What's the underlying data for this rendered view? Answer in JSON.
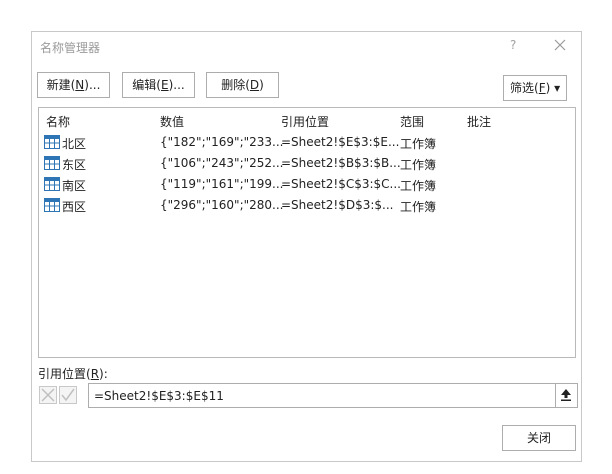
{
  "window": {
    "title": "名称管理器",
    "help": "?"
  },
  "toolbar": {
    "new_label": "新建(",
    "new_key": "N",
    "new_suffix": ")...",
    "edit_label": "编辑(",
    "edit_key": "E",
    "edit_suffix": ")...",
    "delete_label": "删除(",
    "delete_key": "D",
    "delete_suffix": ")",
    "filter_label": "筛选(",
    "filter_key": "F",
    "filter_suffix": ") ▾"
  },
  "list": {
    "headers": {
      "name": "名称",
      "value": "数值",
      "refers_to": "引用位置",
      "scope": "范围",
      "comment": "批注"
    },
    "rows": [
      {
        "icon": "named-range-icon",
        "name": "北区",
        "value": "{\"182\";\"169\";\"233...",
        "refers_to": "=Sheet2!$E$3:$E...",
        "scope": "工作簿",
        "comment": ""
      },
      {
        "icon": "named-range-icon",
        "name": "东区",
        "value": "{\"106\";\"243\";\"252...",
        "refers_to": "=Sheet2!$B$3:$B...",
        "scope": "工作簿",
        "comment": ""
      },
      {
        "icon": "named-range-icon",
        "name": "南区",
        "value": "{\"119\";\"161\";\"199...",
        "refers_to": "=Sheet2!$C$3:$C...",
        "scope": "工作簿",
        "comment": ""
      },
      {
        "icon": "named-range-icon",
        "name": "西区",
        "value": "{\"296\";\"160\";\"280...",
        "refers_to": "=Sheet2!$D$3:$...",
        "scope": "工作簿",
        "comment": ""
      }
    ]
  },
  "refers_to": {
    "label": "引用位置(",
    "label_key": "R",
    "label_suffix": "):",
    "value": "=Sheet2!$E$3:$E$11"
  },
  "footer": {
    "close_label": "关闭"
  },
  "colors": {
    "icon_blue": "#2e75b6",
    "border": "#adadad",
    "title_gray": "#9a9a9a"
  }
}
